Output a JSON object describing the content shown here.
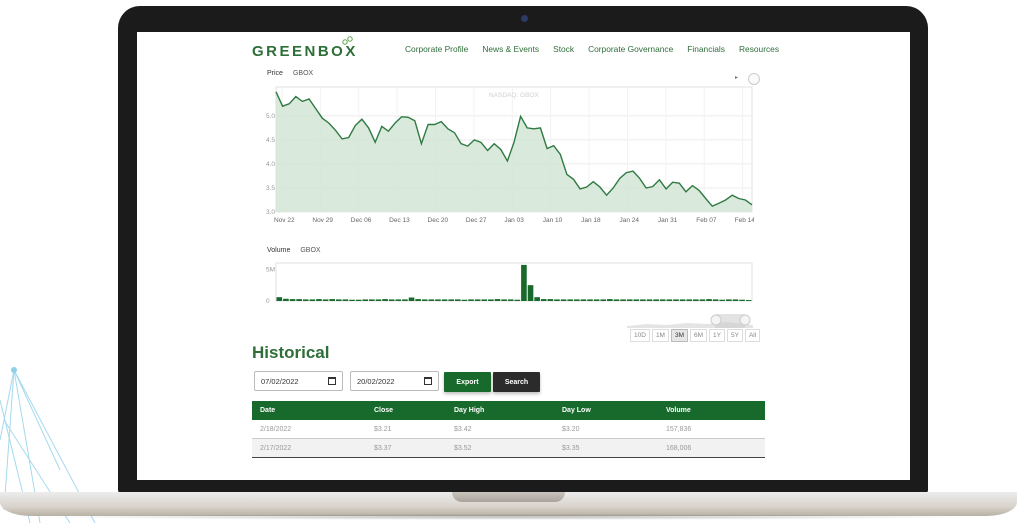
{
  "nav": {
    "logo": "GREENBOX",
    "items": [
      "Corporate Profile",
      "News & Events",
      "Stock",
      "Corporate Governance",
      "Financials",
      "Resources"
    ]
  },
  "price_chart": {
    "label": "Price",
    "symbol": "GBOX",
    "watermark": "NASDAQ: GBOX",
    "menu_icon": "chevron-right-icon",
    "y_ticks": [
      "5.0",
      "4.5",
      "4.0",
      "3.5",
      "3.0"
    ],
    "x_ticks": [
      "Nov 22",
      "Nov 29",
      "Dec 06",
      "Dec 13",
      "Dec 20",
      "Dec 27",
      "Jan 03",
      "Jan 10",
      "Jan 18",
      "Jan 24",
      "Jan 31",
      "Feb 07",
      "Feb 14"
    ],
    "ylim": [
      3.0,
      5.6
    ],
    "values": [
      5.5,
      5.2,
      5.25,
      5.4,
      5.3,
      5.35,
      5.15,
      4.95,
      4.85,
      4.7,
      4.52,
      4.55,
      4.8,
      4.93,
      4.75,
      4.45,
      4.78,
      4.68,
      4.85,
      4.98,
      4.97,
      4.9,
      4.42,
      4.82,
      4.82,
      4.88,
      4.73,
      4.65,
      4.42,
      4.37,
      4.5,
      4.45,
      4.28,
      4.42,
      4.3,
      4.06,
      4.45,
      4.99,
      4.75,
      4.73,
      4.75,
      4.32,
      4.38,
      4.2,
      3.78,
      3.68,
      3.48,
      3.52,
      3.63,
      3.52,
      3.35,
      3.5,
      3.7,
      3.82,
      3.85,
      3.7,
      3.5,
      3.53,
      3.67,
      3.48,
      3.62,
      3.6,
      3.42,
      3.55,
      3.45,
      3.28,
      3.12,
      3.18,
      3.25,
      3.35,
      3.28,
      3.25,
      3.15
    ]
  },
  "volume_chart": {
    "label": "Volume",
    "symbol": "GBOX",
    "y_ticks": [
      "5M",
      "0"
    ],
    "ylim": [
      0,
      6
    ],
    "values": [
      0.6,
      0.35,
      0.3,
      0.3,
      0.25,
      0.25,
      0.3,
      0.25,
      0.3,
      0.25,
      0.25,
      0.2,
      0.2,
      0.25,
      0.25,
      0.25,
      0.3,
      0.25,
      0.25,
      0.25,
      0.55,
      0.3,
      0.25,
      0.25,
      0.25,
      0.25,
      0.25,
      0.25,
      0.2,
      0.25,
      0.25,
      0.25,
      0.25,
      0.3,
      0.25,
      0.25,
      0.2,
      5.7,
      2.5,
      0.6,
      0.3,
      0.3,
      0.25,
      0.25,
      0.25,
      0.25,
      0.25,
      0.25,
      0.25,
      0.25,
      0.3,
      0.25,
      0.25,
      0.25,
      0.25,
      0.25,
      0.25,
      0.25,
      0.25,
      0.25,
      0.25,
      0.25,
      0.25,
      0.25,
      0.25,
      0.3,
      0.25,
      0.2,
      0.25,
      0.25,
      0.2,
      0.15
    ]
  },
  "ranges": {
    "items": [
      "10D",
      "1M",
      "3M",
      "6M",
      "1Y",
      "5Y",
      "All"
    ],
    "active": "3M"
  },
  "historical": {
    "title": "Historical",
    "start_date": "07/02/2022",
    "end_date": "20/02/2022",
    "export_label": "Export",
    "search_label": "Search",
    "headers": [
      "Date",
      "Close",
      "Day High",
      "Day Low",
      "Volume"
    ],
    "rows": [
      [
        "2/18/2022",
        "$3.21",
        "$3.42",
        "$3.20",
        "157,836"
      ],
      [
        "2/17/2022",
        "$3.37",
        "$3.52",
        "$3.35",
        "168,006"
      ]
    ]
  },
  "colors": {
    "brand_green": "#176a2b",
    "line_green": "#2f7a42",
    "area_green": "#cfe3d2"
  }
}
